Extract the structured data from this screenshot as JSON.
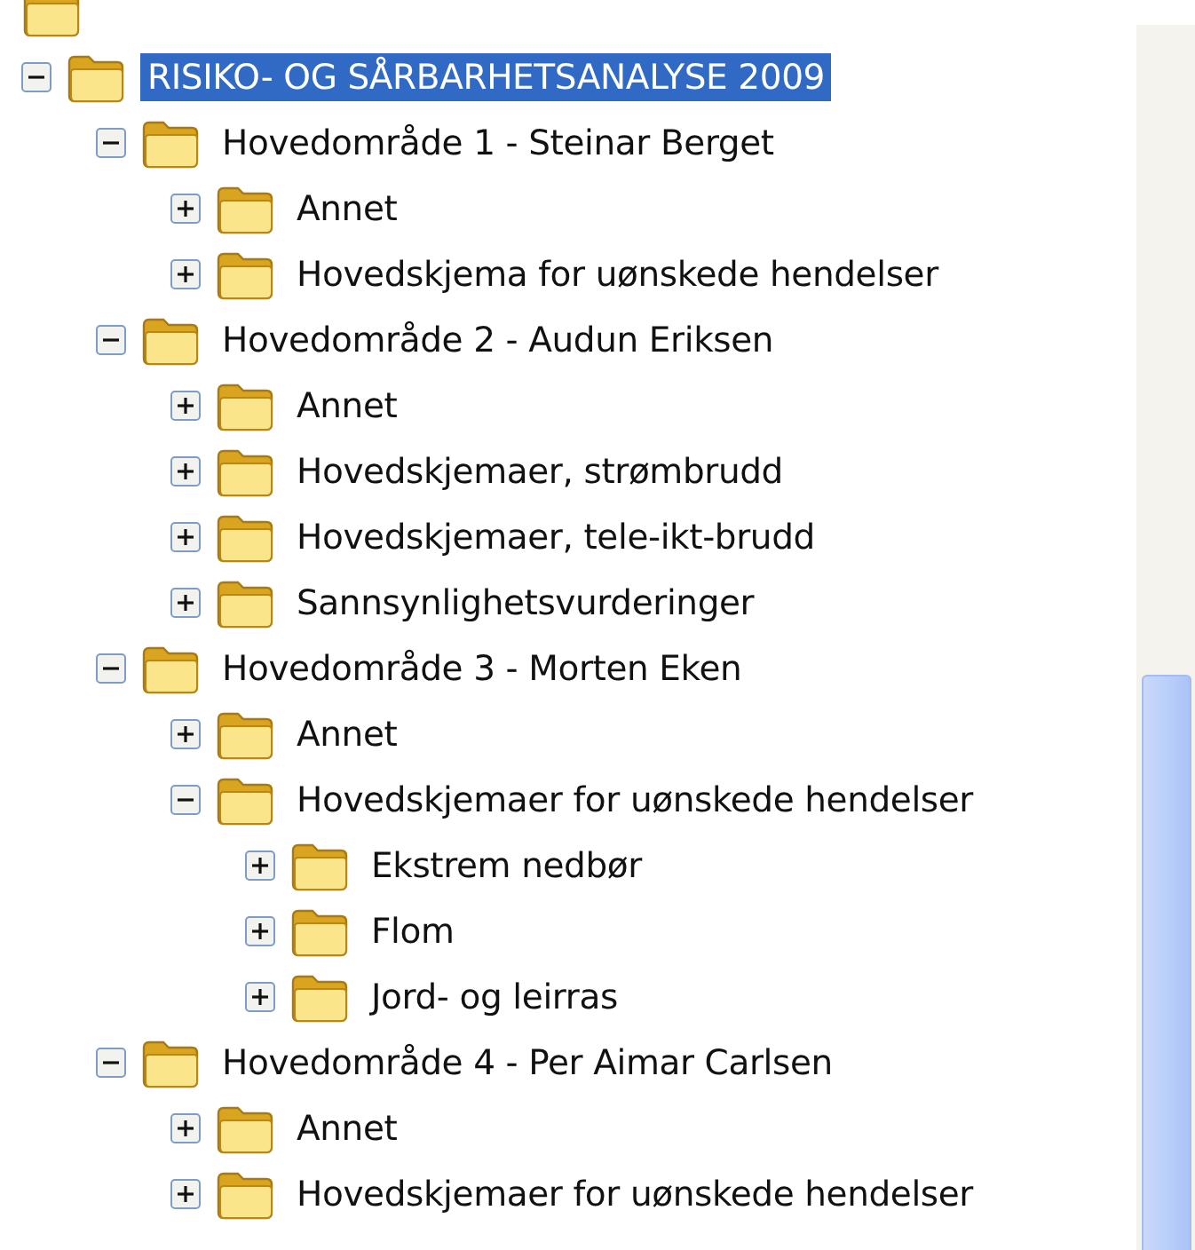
{
  "tree": [
    {
      "label": "RISIKO- OG SÅRBARHETSANALYSE 2009",
      "expanded": true,
      "selected": true,
      "children": [
        {
          "label": "Hovedområde 1 - Steinar Berget",
          "expanded": true,
          "selected": false,
          "children": [
            {
              "label": "Annet",
              "expanded": false,
              "selected": false
            },
            {
              "label": "Hovedskjema for uønskede hendelser",
              "expanded": false,
              "selected": false
            }
          ]
        },
        {
          "label": "Hovedområde 2 - Audun Eriksen",
          "expanded": true,
          "selected": false,
          "children": [
            {
              "label": "Annet",
              "expanded": false,
              "selected": false
            },
            {
              "label": "Hovedskjemaer, strømbrudd",
              "expanded": false,
              "selected": false
            },
            {
              "label": "Hovedskjemaer, tele-ikt-brudd",
              "expanded": false,
              "selected": false
            },
            {
              "label": "Sannsynlighetsvurderinger",
              "expanded": false,
              "selected": false
            }
          ]
        },
        {
          "label": "Hovedområde 3 - Morten Eken",
          "expanded": true,
          "selected": false,
          "children": [
            {
              "label": "Annet",
              "expanded": false,
              "selected": false
            },
            {
              "label": "Hovedskjemaer for uønskede hendelser",
              "expanded": true,
              "selected": false,
              "children": [
                {
                  "label": "Ekstrem nedbør",
                  "expanded": false,
                  "selected": false
                },
                {
                  "label": "Flom",
                  "expanded": false,
                  "selected": false
                },
                {
                  "label": "Jord- og leirras",
                  "expanded": false,
                  "selected": false
                }
              ]
            }
          ]
        },
        {
          "label": "Hovedområde 4 - Per Aimar Carlsen",
          "expanded": true,
          "selected": false,
          "children": [
            {
              "label": "Annet",
              "expanded": false,
              "selected": false
            },
            {
              "label": "Hovedskjemaer for uønskede hendelser",
              "expanded": false,
              "selected": false
            }
          ]
        }
      ]
    }
  ]
}
